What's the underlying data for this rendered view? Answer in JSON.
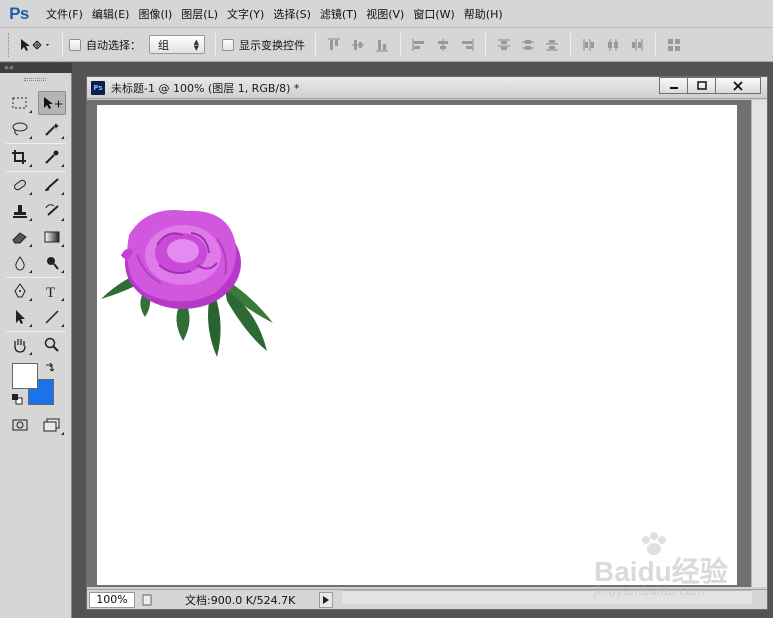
{
  "app": {
    "logo": "Ps"
  },
  "menu": [
    {
      "label": "文件(F)"
    },
    {
      "label": "编辑(E)"
    },
    {
      "label": "图像(I)"
    },
    {
      "label": "图层(L)"
    },
    {
      "label": "文字(Y)"
    },
    {
      "label": "选择(S)"
    },
    {
      "label": "滤镜(T)"
    },
    {
      "label": "视图(V)"
    },
    {
      "label": "窗口(W)"
    },
    {
      "label": "帮助(H)"
    }
  ],
  "options": {
    "auto_select_label": "自动选择：",
    "auto_select_checked": false,
    "auto_select_value": "组",
    "show_transform_label": "显示变换控件",
    "show_transform_checked": false
  },
  "tools": {
    "foreground_color": "#ffffff",
    "background_color": "#1a73e8"
  },
  "document": {
    "icon_label": "Ps",
    "title": "未标题-1 @ 100% (图层 1, RGB/8) *",
    "minimize_label": "▬",
    "maximize_label": "□",
    "close_label": "✕",
    "zoom": "100%",
    "info": "文档:900.0 K/524.7K",
    "flower_colors": {
      "petal": "#c640d6",
      "petal_light": "#e48af0",
      "leaf": "#3b7a3a"
    }
  },
  "watermark": {
    "brand": "Baidu经验",
    "url": "jingyan.baidu.com"
  }
}
